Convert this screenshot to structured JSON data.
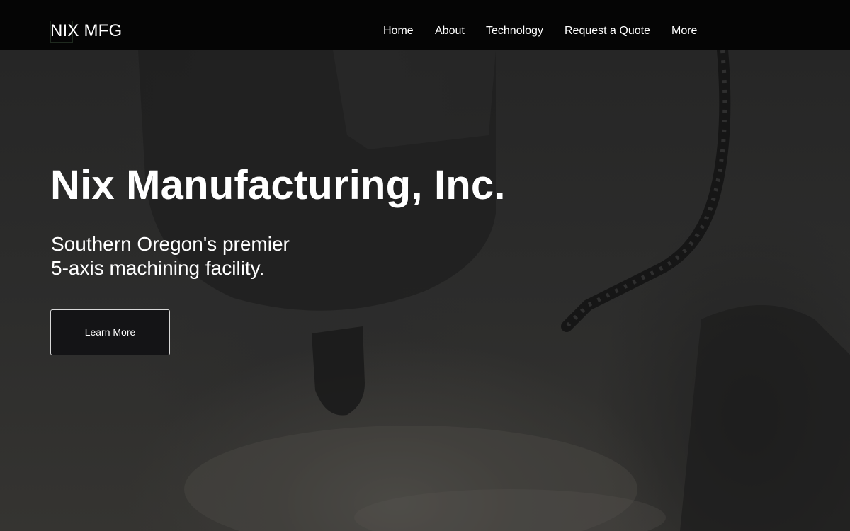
{
  "header": {
    "brand": "NIX MFG",
    "nav": [
      {
        "label": "Home"
      },
      {
        "label": "About"
      },
      {
        "label": "Technology"
      },
      {
        "label": "Request a Quote"
      },
      {
        "label": "More"
      }
    ]
  },
  "hero": {
    "title": "Nix Manufacturing, Inc.",
    "subtitle_lines": [
      "Southern Oregon's premier",
      "5-axis machining facility."
    ],
    "cta_label": "Learn More"
  },
  "colors": {
    "header_bg": "#050505",
    "text": "#ffffff",
    "button_bg": "#141416",
    "button_border": "#d8d8d8"
  }
}
